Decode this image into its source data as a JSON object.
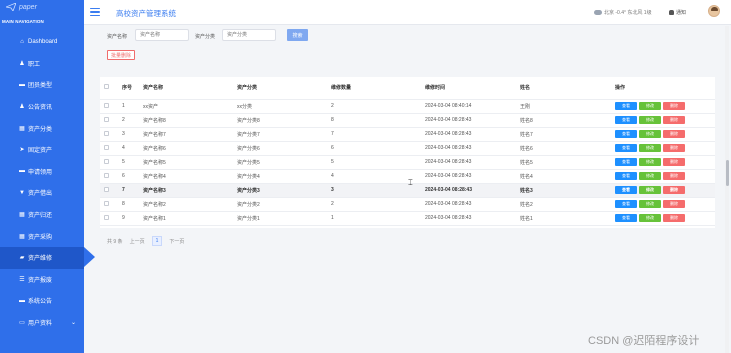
{
  "logo": {
    "text": "paper"
  },
  "sidebar": {
    "nav_title": "MAIN NAVIGATION",
    "items": [
      {
        "label": "Dashboard",
        "icon": "home-icon",
        "glyph": "⌂"
      },
      {
        "label": "职工",
        "icon": "user-icon",
        "glyph": "♟"
      },
      {
        "label": "团员类型",
        "icon": "card-icon",
        "glyph": "▬"
      },
      {
        "label": "公告资讯",
        "icon": "user-icon",
        "glyph": "♟"
      },
      {
        "label": "资产分类",
        "icon": "grid-icon",
        "glyph": "▦"
      },
      {
        "label": "固定资产",
        "icon": "send-icon",
        "glyph": "➤"
      },
      {
        "label": "申请领用",
        "icon": "card-icon",
        "glyph": "▬"
      },
      {
        "label": "资产借出",
        "icon": "filter-icon",
        "glyph": "▼"
      },
      {
        "label": "资产归还",
        "icon": "grid-icon",
        "glyph": "▦"
      },
      {
        "label": "资产采购",
        "icon": "grid-icon",
        "glyph": "▦"
      },
      {
        "label": "资产维修",
        "icon": "car-icon",
        "glyph": "▰"
      },
      {
        "label": "资产报废",
        "icon": "list-icon",
        "glyph": "☰"
      },
      {
        "label": "系统公告",
        "icon": "card-icon",
        "glyph": "▬"
      },
      {
        "label": "用户资料",
        "icon": "folder-icon",
        "glyph": "▭"
      }
    ],
    "active_index": 10
  },
  "topbar": {
    "title": "高校资产管理系统",
    "weather": "北京 -0.4° 东北风 1级",
    "notice": "通知"
  },
  "search": {
    "name_label": "资产名称",
    "name_placeholder": "资产名称",
    "category_label": "资产分类",
    "category_placeholder": "资产分类",
    "search_button": "搜索",
    "batch_delete_button": "批量删除"
  },
  "table": {
    "headers": [
      "序号",
      "资产名称",
      "资产分类",
      "维修数量",
      "维修时间",
      "姓名",
      "操作"
    ],
    "rows": [
      [
        "1",
        "xx资产",
        "xx分类",
        "2",
        "2024-03-04 08:40:14",
        "王刚"
      ],
      [
        "2",
        "资产名称8",
        "资产分类8",
        "8",
        "2024-03-04 08:28:43",
        "姓名8"
      ],
      [
        "3",
        "资产名称7",
        "资产分类7",
        "7",
        "2024-03-04 08:28:43",
        "姓名7"
      ],
      [
        "4",
        "资产名称6",
        "资产分类6",
        "6",
        "2024-03-04 08:28:43",
        "姓名6"
      ],
      [
        "5",
        "资产名称5",
        "资产分类5",
        "5",
        "2024-03-04 08:28:43",
        "姓名5"
      ],
      [
        "6",
        "资产名称4",
        "资产分类4",
        "4",
        "2024-03-04 08:28:43",
        "姓名4"
      ],
      [
        "7",
        "资产名称3",
        "资产分类3",
        "3",
        "2024-03-04 08:28:43",
        "姓名3"
      ],
      [
        "8",
        "资产名称2",
        "资产分类2",
        "2",
        "2024-03-04 08:28:43",
        "姓名2"
      ],
      [
        "9",
        "资产名称1",
        "资产分类1",
        "1",
        "2024-03-04 08:28:43",
        "姓名1"
      ]
    ],
    "highlighted_row": 6,
    "actions": {
      "view": "查看",
      "edit": "修改",
      "delete": "删除"
    }
  },
  "pager": {
    "total": "共 9 条",
    "prev": "上一页",
    "current": "1",
    "next": "下一页"
  },
  "watermark": "CSDN @迟陌程序设计"
}
